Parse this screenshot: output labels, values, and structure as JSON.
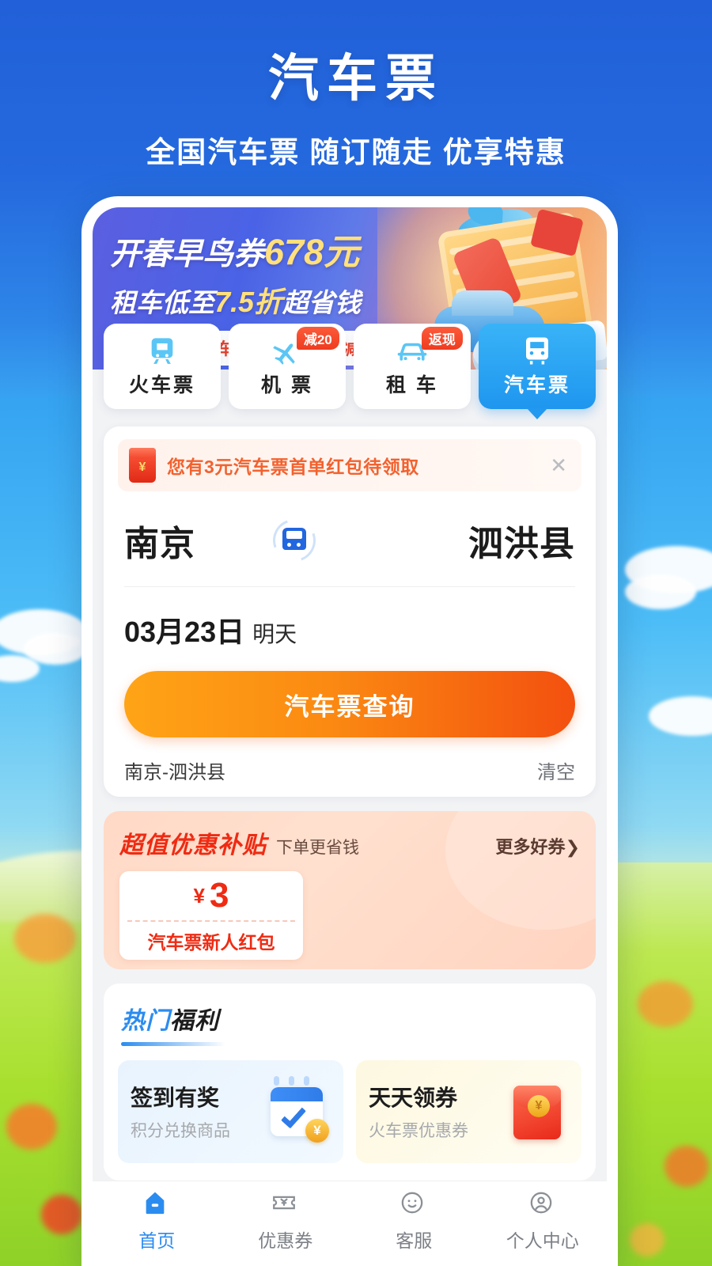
{
  "header": {
    "title": "汽车票",
    "subtitle": "全国汽车票 随订随走 优享特惠"
  },
  "promo_banner": {
    "line1_text": "开春早鸟券",
    "line1_amount": "678元",
    "line2_text": "租车低至",
    "line2_amount": "7.5折",
    "line2_tail": "超省钱",
    "pill_label": "机票·租车·火车票·汽车票 都可减",
    "pill_arrow": "❯"
  },
  "tabs": [
    {
      "label": "火车票",
      "icon": "train-icon",
      "badge": "",
      "active": false
    },
    {
      "label": "机 票",
      "icon": "plane-icon",
      "badge": "减20",
      "active": false
    },
    {
      "label": "租 车",
      "icon": "car-icon",
      "badge": "返现",
      "active": false
    },
    {
      "label": "汽车票",
      "icon": "bus-icon",
      "badge": "",
      "active": true
    }
  ],
  "notice": {
    "text": "您有3元汽车票首单红包待领取",
    "close_label": "✕",
    "icon": "red-packet-icon"
  },
  "search": {
    "from_city": "南京",
    "to_city": "泗洪县",
    "swap_icon": "bus-swap-icon",
    "date": "03月23日",
    "date_note": "明天",
    "cta_label": "汽车票查询",
    "history_route": "南京-泗洪县",
    "history_clear": "清空"
  },
  "coupons": {
    "title": "超值优惠补贴",
    "subtitle": "下单更省钱",
    "more_label": "更多好券",
    "more_arrow": "❯",
    "card": {
      "currency": "¥",
      "amount": "3",
      "name": "汽车票新人红包"
    }
  },
  "hot": {
    "title_accent": "热门",
    "title_rest": "福利",
    "cards": [
      {
        "title": "签到有奖",
        "subtitle": "积分兑换商品",
        "icon": "calendar-check-icon"
      },
      {
        "title": "天天领券",
        "subtitle": "火车票优惠券",
        "icon": "red-envelope-icon"
      }
    ]
  },
  "bottom_nav": [
    {
      "label": "首页",
      "icon": "home-icon",
      "active": true
    },
    {
      "label": "优惠券",
      "icon": "coupon-icon",
      "active": false
    },
    {
      "label": "客服",
      "icon": "support-smiley-icon",
      "active": false
    },
    {
      "label": "个人中心",
      "icon": "user-profile-icon",
      "active": false
    }
  ],
  "colors": {
    "header_blue": "#2160d8",
    "accent_blue": "#2b8cf0",
    "cta_orange_start": "#ffa416",
    "cta_orange_end": "#f3500f",
    "coupon_red": "#ef2b13",
    "badge_red": "#ef3b20"
  }
}
